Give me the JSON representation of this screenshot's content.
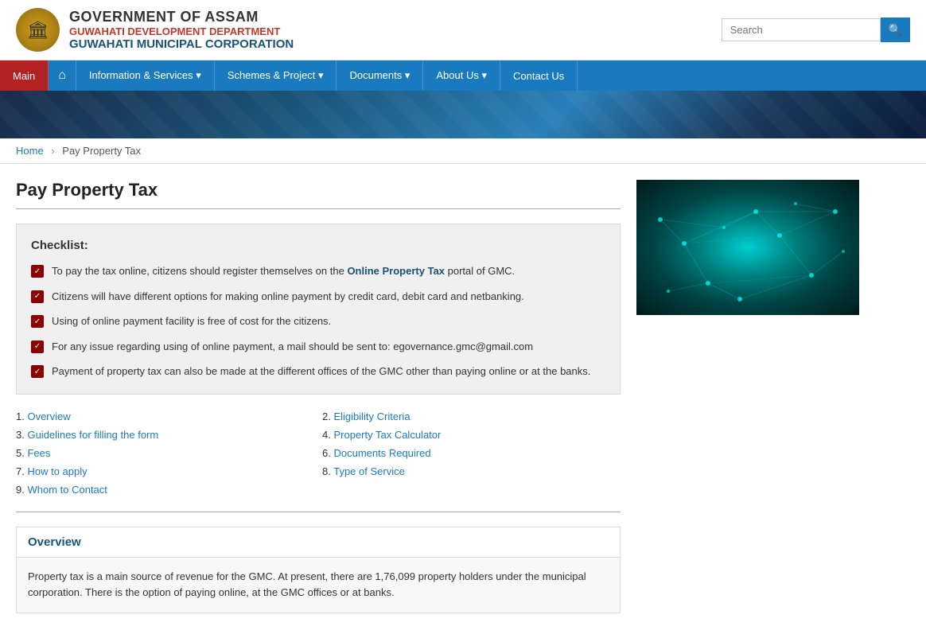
{
  "header": {
    "emblem": "🏛",
    "title_main": "GOVERNMENT OF ASSAM",
    "title_sub": "GUWAHATI DEVELOPMENT DEPARTMENT",
    "title_corp": "GUWAHATI MUNICIPAL CORPORATION",
    "search_placeholder": "Search"
  },
  "navbar": {
    "items": [
      {
        "id": "main",
        "label": "Main",
        "active": true
      },
      {
        "id": "home",
        "label": "⌂",
        "active": false
      },
      {
        "id": "info",
        "label": "Information & Services ▾",
        "active": false
      },
      {
        "id": "schemes",
        "label": "Schemes & Project ▾",
        "active": false
      },
      {
        "id": "documents",
        "label": "Documents ▾",
        "active": false
      },
      {
        "id": "about",
        "label": "About Us ▾",
        "active": false
      },
      {
        "id": "contact",
        "label": "Contact Us",
        "active": false
      }
    ]
  },
  "breadcrumb": {
    "home": "Home",
    "separator": "›",
    "current": "Pay Property Tax"
  },
  "page": {
    "title": "Pay Property Tax"
  },
  "checklist": {
    "title": "Checklist:",
    "items": [
      {
        "text_before": "To pay the tax online, citizens should register themselves on the ",
        "link_text": "Online Property Tax",
        "text_after": " portal of GMC."
      },
      {
        "text": "Citizens will have different options for making online payment by credit card, debit card and netbanking."
      },
      {
        "text": "Using of online payment facility is free of cost for the citizens."
      },
      {
        "text": "For any issue regarding using of online payment, a mail should be sent to: egovernance.gmc@gmail.com"
      },
      {
        "text": "Payment of property tax can also be made at the different offices of the GMC other than paying online or at the banks."
      }
    ]
  },
  "links": [
    {
      "num": "1.",
      "label": "Overview",
      "href": "#overview"
    },
    {
      "num": "2.",
      "label": "Eligibility Criteria",
      "href": "#eligibility"
    },
    {
      "num": "3.",
      "label": "Guidelines for filling the form",
      "href": "#guidelines"
    },
    {
      "num": "4.",
      "label": "Property Tax Calculator",
      "href": "#calculator"
    },
    {
      "num": "5.",
      "label": "Fees",
      "href": "#fees"
    },
    {
      "num": "6.",
      "label": "Documents Required",
      "href": "#documents"
    },
    {
      "num": "7.",
      "label": "How to apply",
      "href": "#how-to-apply"
    },
    {
      "num": "8.",
      "label": "Type of Service",
      "href": "#type-of-service"
    },
    {
      "num": "9.",
      "label": "Whom to Contact",
      "href": "#contact"
    }
  ],
  "overview": {
    "title": "Overview",
    "body": "Property tax is a main source of revenue for the GMC. At present, there are 1,76,099 property holders under the municipal corporation. There is the option of paying online, at the GMC offices or at banks."
  }
}
